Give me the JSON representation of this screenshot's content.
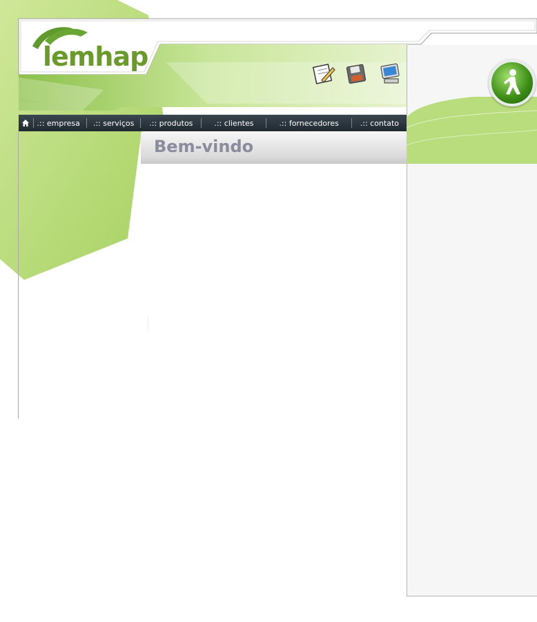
{
  "header": {
    "logo": "lemhap",
    "pattern_label": "::::::..."
  },
  "toolbar": {
    "icons": [
      "notepad-pencil-icon",
      "floppy-disk-icon",
      "computer-monitor-icon"
    ]
  },
  "nav": {
    "home_icon": "home-icon",
    "items": [
      ".:: empresa",
      ".:: serviços",
      ".:: produtos",
      ".:: clientes",
      ".:: fornecedores",
      ".:: contato"
    ]
  },
  "main": {
    "title": "Bem-vindo"
  },
  "right": {
    "button_icon": "walking-person-icon"
  },
  "colors": {
    "green": "#a6d160",
    "nav_bg": "#26323a",
    "title": "#8b8b9e"
  }
}
